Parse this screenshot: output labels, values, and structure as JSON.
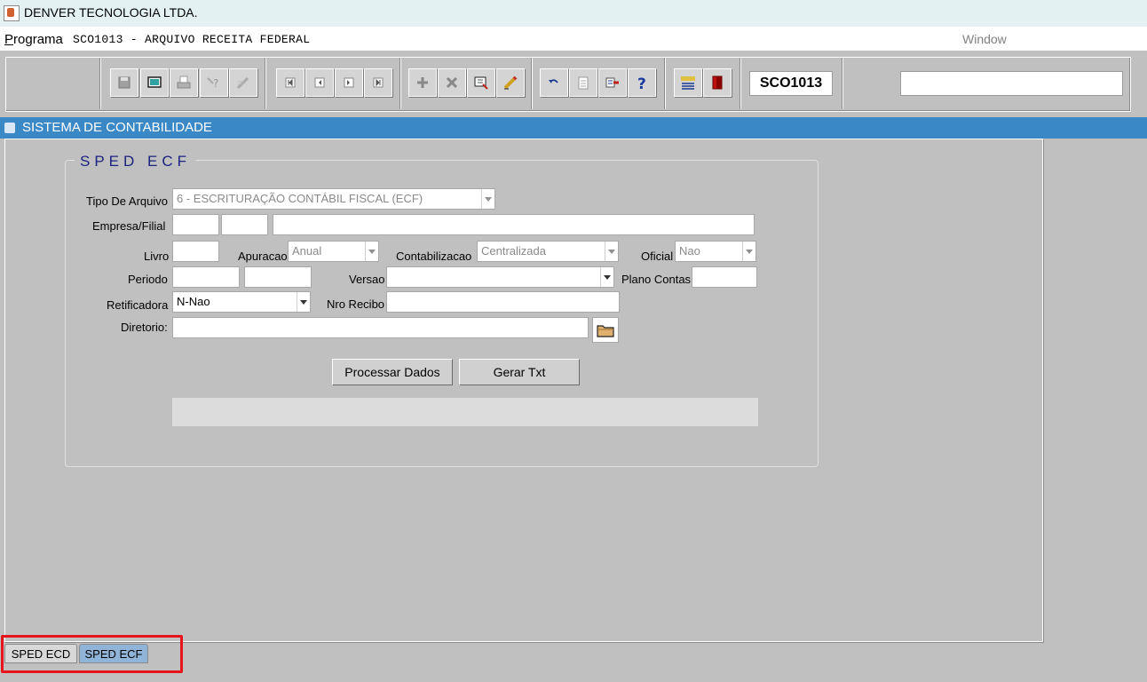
{
  "window": {
    "title": "DENVER TECNOLOGIA LTDA."
  },
  "menubar": {
    "programa": "Programa",
    "program_name": "SCO1013 - ARQUIVO RECEITA FEDERAL",
    "window": "Window"
  },
  "toolbar": {
    "form_code": "SCO1013",
    "buttons": [
      "save",
      "enter-query",
      "print",
      "help-query",
      "edit",
      "first-record",
      "previous-record",
      "next-record",
      "last-record",
      "insert-record",
      "delete-record",
      "execute-query",
      "clear",
      "undo",
      "copy",
      "list",
      "help",
      "menu",
      "exit"
    ]
  },
  "header": {
    "title": "SISTEMA DE CONTABILIDADE"
  },
  "form": {
    "group_title": "SPED ECF",
    "tipo_arquivo": {
      "label": "Tipo De Arquivo",
      "value": "6 - ESCRITURAÇÃO CONTÁBIL FISCAL (ECF)"
    },
    "empresa_filial": {
      "label": "Empresa/Filial",
      "empresa": "",
      "filial": "",
      "nome": ""
    },
    "livro": {
      "label": "Livro",
      "value": ""
    },
    "apuracao": {
      "label": "Apuracao",
      "value": "Anual"
    },
    "contabilizacao": {
      "label": "Contabilizacao",
      "value": "Centralizada"
    },
    "oficial": {
      "label": "Oficial",
      "value": "Nao"
    },
    "periodo": {
      "label": "Periodo",
      "inicio": "",
      "fim": ""
    },
    "versao": {
      "label": "Versao",
      "value": ""
    },
    "plano_contas": {
      "label": "Plano Contas",
      "value": ""
    },
    "retificadora": {
      "label": "Retificadora",
      "value": "N-Nao"
    },
    "nro_recibo": {
      "label": "Nro Recibo",
      "value": ""
    },
    "diretorio": {
      "label": "Diretorio:",
      "value": ""
    },
    "processar_label": "Processar Dados",
    "gerar_label": "Gerar Txt"
  },
  "tabs": [
    {
      "label": "SPED ECD",
      "active": false
    },
    {
      "label": "SPED ECF",
      "active": true
    }
  ],
  "colors": {
    "header": "#3b88c7",
    "active_tab": "#8fb4d8",
    "highlight": "#e8141c",
    "group_title": "#1a237e"
  }
}
